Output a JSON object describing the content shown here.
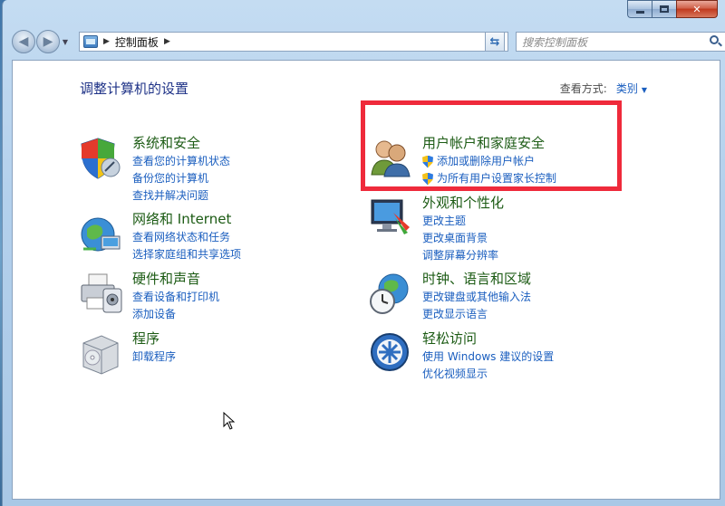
{
  "window": {
    "caption": {
      "min": "",
      "max": "",
      "close": "✕"
    }
  },
  "navbar": {
    "breadcrumb": "控制面板",
    "search_placeholder": "搜索控制面板"
  },
  "page": {
    "title": "调整计算机的设置",
    "view_by_label": "查看方式:",
    "view_by_value": "类别"
  },
  "categories": [
    {
      "title": "系统和安全",
      "links": [
        "查看您的计算机状态",
        "备份您的计算机",
        "查找并解决问题"
      ],
      "icon": "shield-icon"
    },
    {
      "title": "网络和 Internet",
      "links": [
        "查看网络状态和任务",
        "选择家庭组和共享选项"
      ],
      "icon": "network-globe-icon"
    },
    {
      "title": "硬件和声音",
      "links": [
        "查看设备和打印机",
        "添加设备"
      ],
      "icon": "printer-icon"
    },
    {
      "title": "程序",
      "links": [
        "卸载程序"
      ],
      "icon": "programs-box-icon"
    },
    {
      "title": "用户帐户和家庭安全",
      "links": [
        "添加或删除用户帐户",
        "为所有用户设置家长控制"
      ],
      "icon": "users-icon"
    },
    {
      "title": "外观和个性化",
      "links": [
        "更改主题",
        "更改桌面背景",
        "调整屏幕分辨率"
      ],
      "icon": "monitor-paint-icon"
    },
    {
      "title": "时钟、语言和区域",
      "links": [
        "更改键盘或其他输入法",
        "更改显示语言"
      ],
      "icon": "clock-globe-icon"
    },
    {
      "title": "轻松访问",
      "links": [
        "使用 Windows 建议的设置",
        "优化视频显示"
      ],
      "icon": "ease-of-access-icon"
    }
  ],
  "colors": {
    "highlight_border": "#ef2a3b",
    "link": "#1a5ebf",
    "category_title": "#1c5b14"
  }
}
